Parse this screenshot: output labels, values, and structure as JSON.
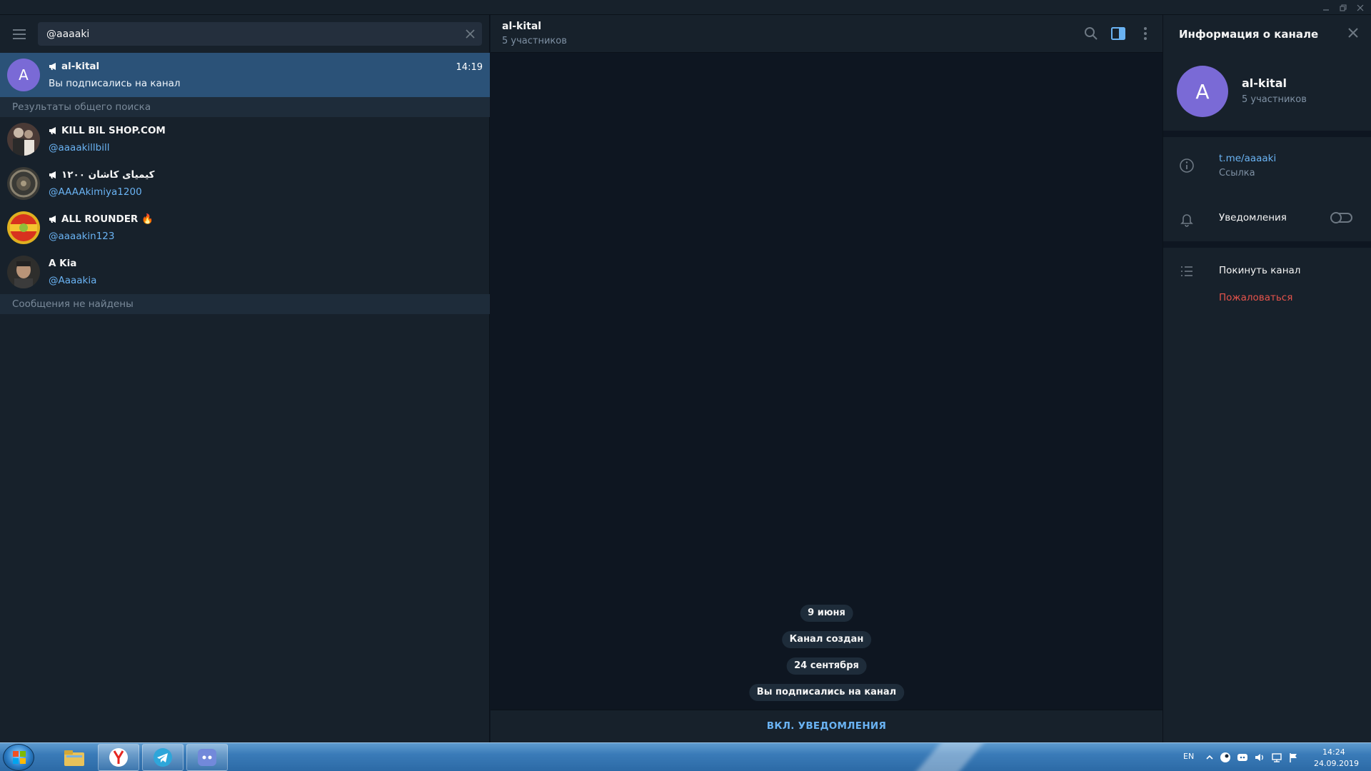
{
  "search": {
    "value": "@aaaaki"
  },
  "active_chat": {
    "avatar_letter": "A",
    "name": "al-kital",
    "time": "14:19",
    "last_message": "Вы подписались на канал"
  },
  "sections": {
    "global_results": "Результаты общего поиска",
    "no_messages": "Сообщения не найдены"
  },
  "results": [
    {
      "name": "KILL BIL SHOP.COM",
      "handle": "@aaaakillbill",
      "channel": true
    },
    {
      "name": "کیمیای کاشان ۱۲۰۰",
      "handle": "@AAAAkimiya1200",
      "channel": true
    },
    {
      "name": "ALL ROUNDER 🔥",
      "handle": "@aaaakin123",
      "channel": true
    },
    {
      "name": "A Kia",
      "handle": "@Aaaakia",
      "channel": false
    }
  ],
  "chat": {
    "title": "al-kital",
    "subtitle": "5 участников",
    "service_messages": [
      "9 июня",
      "Канал создан",
      "24 сентября",
      "Вы подписались на канал"
    ],
    "footer_action": "ВКЛ. УВЕДОМЛЕНИЯ"
  },
  "info_panel": {
    "title": "Информация о канале",
    "avatar_letter": "A",
    "name": "al-kital",
    "members": "5 участников",
    "link_value": "t.me/aaaaki",
    "link_label": "Ссылка",
    "notifications_label": "Уведомления",
    "notifications_on": false,
    "leave_label": "Покинуть канал",
    "report_label": "Пожаловаться"
  },
  "taskbar": {
    "language": "EN",
    "time": "14:24",
    "date": "24.09.2019"
  },
  "colors": {
    "accent": "#6ab3f3",
    "active_row": "#2b5278",
    "avatar": "#7a6ad6",
    "danger": "#e5534b"
  }
}
